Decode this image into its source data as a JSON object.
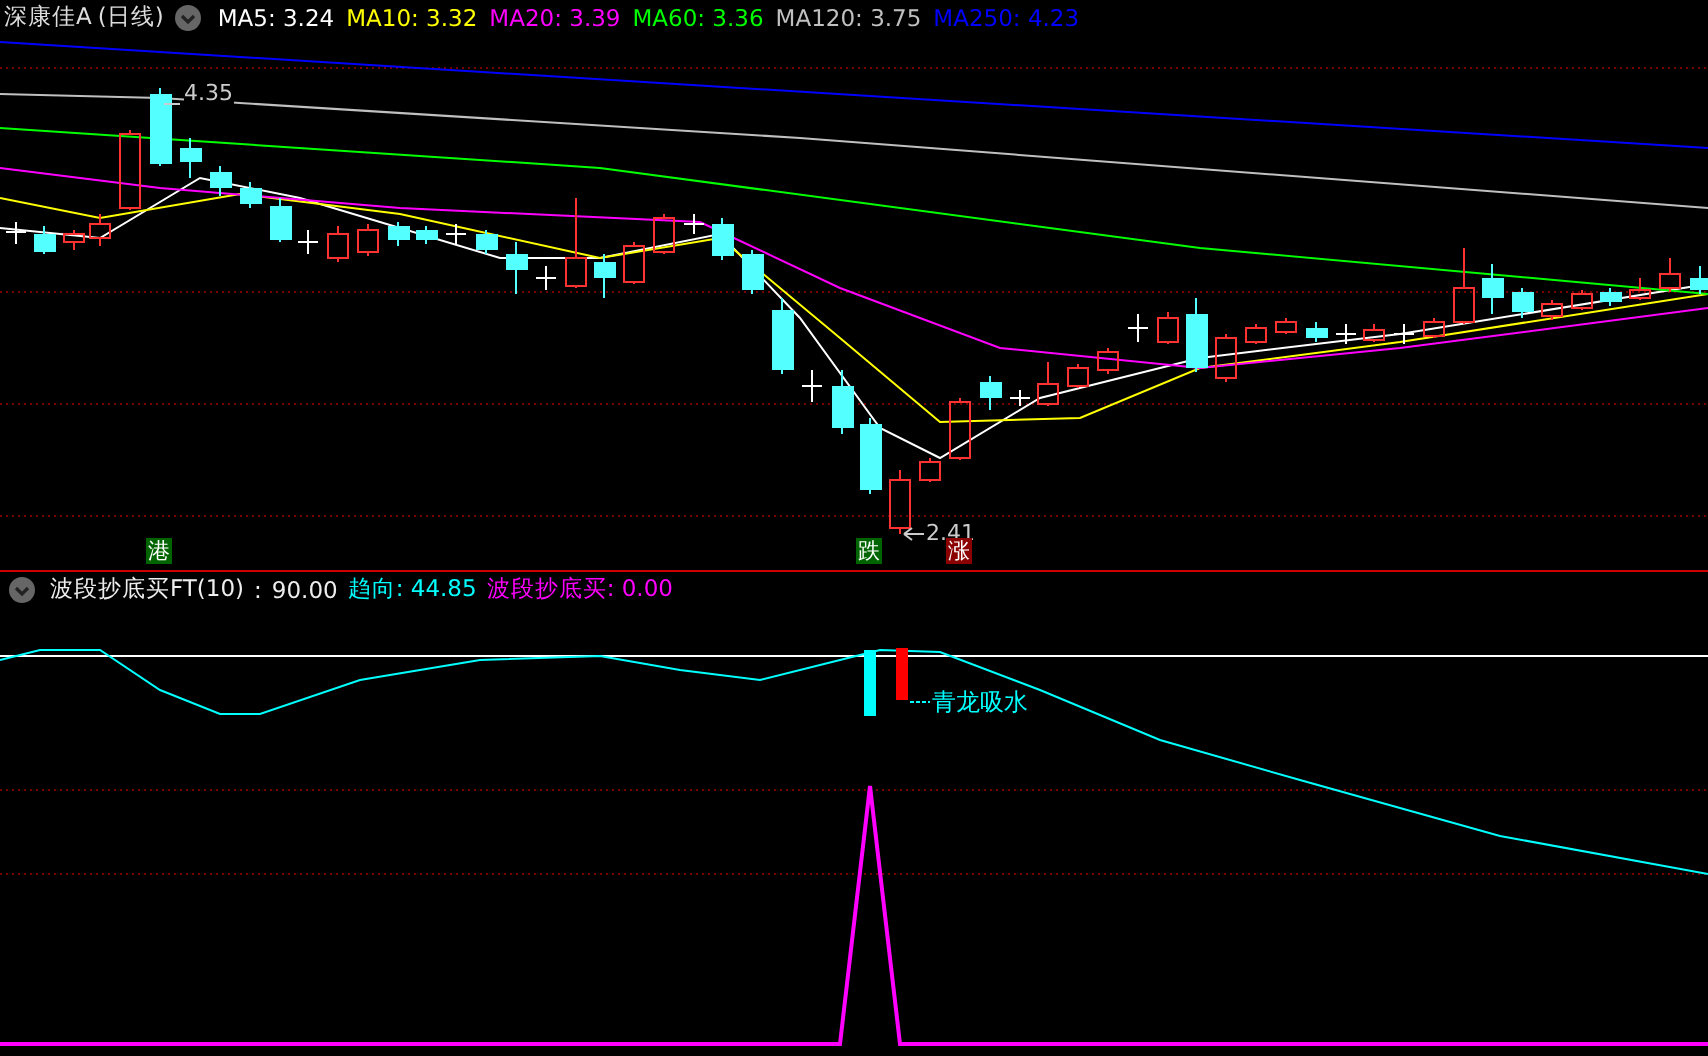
{
  "header": {
    "stock": "深康佳A",
    "period": "(日线)",
    "averages": [
      {
        "text": "MA5: 3.24",
        "color": "#ffffff"
      },
      {
        "text": "MA10: 3.32",
        "color": "#ffff00"
      },
      {
        "text": "MA20: 3.39",
        "color": "#ff00ff"
      },
      {
        "text": "MA60: 3.36",
        "color": "#00ff00"
      },
      {
        "text": "MA120: 3.75",
        "color": "#c0c0c0"
      },
      {
        "text": "MA250: 4.23",
        "color": "#0000ff"
      }
    ]
  },
  "main_chart": {
    "high_label": "4.35",
    "low_label": "2.41",
    "signals": [
      {
        "text": "港",
        "kind": "down"
      },
      {
        "text": "跌",
        "kind": "down"
      },
      {
        "text": "涨",
        "kind": "up"
      }
    ]
  },
  "indicator": {
    "name": "波段抄底买FT(10)",
    "separator": ":",
    "value": "90.00",
    "lines": [
      {
        "text": "趋向: 44.85",
        "color": "#00ffff"
      },
      {
        "text": "波段抄底买: 0.00",
        "color": "#ff00ff"
      }
    ],
    "annotation": "青龙吸水"
  }
}
